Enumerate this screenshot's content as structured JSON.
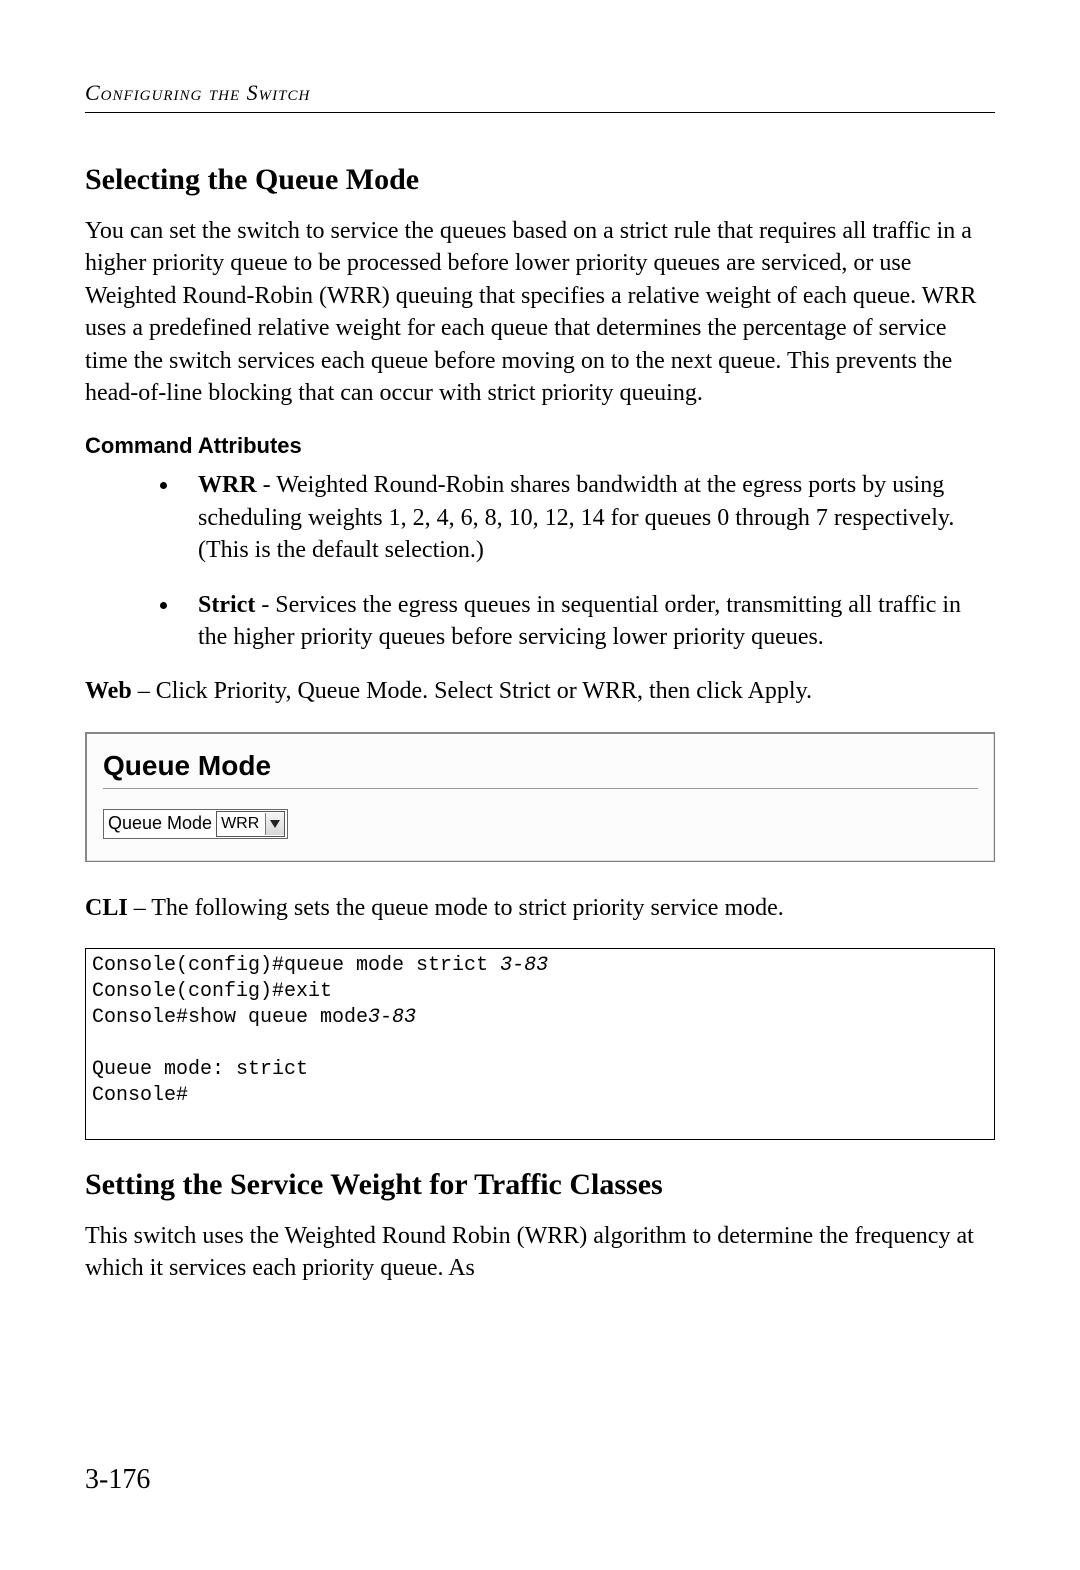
{
  "running_head": "Configuring the Switch",
  "section1": {
    "title": "Selecting the Queue Mode",
    "intro": "You can set the switch to service the queues based on a strict rule that requires all traffic in a higher priority queue to be processed before lower priority queues are serviced, or use Weighted Round-Robin (WRR) queuing that specifies a relative weight of each queue. WRR uses a predefined relative weight for each queue that determines the percentage of service time the switch services each queue before moving on to the next queue. This prevents the head-of-line blocking that can occur with strict priority queuing.",
    "attrs_head": "Command Attributes",
    "attrs": [
      {
        "name": "WRR",
        "desc": " - Weighted Round-Robin shares bandwidth at the egress ports by using scheduling weights 1, 2, 4, 6, 8, 10, 12, 14 for queues 0 through 7 respectively. (This is the default selection.)"
      },
      {
        "name": "Strict",
        "desc": " - Services the egress queues in sequential order, transmitting all traffic in the higher priority queues before servicing lower priority queues."
      }
    ],
    "web_lead": "Web",
    "web_text": " – Click Priority, Queue Mode. Select Strict or WRR, then click Apply.",
    "panel_title": "Queue Mode",
    "panel_label": "Queue Mode",
    "panel_select_value": "WRR",
    "cli_lead": "CLI",
    "cli_text": " – The following sets the queue mode to strict priority service mode.",
    "cli_lines": {
      "l1a": "Console(config)#queue mode strict ",
      "l1b": "3-83",
      "l2": "Console(config)#exit",
      "l3a": "Console#show queue mode",
      "l3b": "3-83",
      "l4": "",
      "l5": "Queue mode: strict",
      "l6": "Console#"
    }
  },
  "section2": {
    "title": "Setting the Service Weight for Traffic Classes",
    "intro": "This switch uses the Weighted Round Robin (WRR) algorithm to determine the frequency at which it services each priority queue. As"
  },
  "page_number": "3-176"
}
